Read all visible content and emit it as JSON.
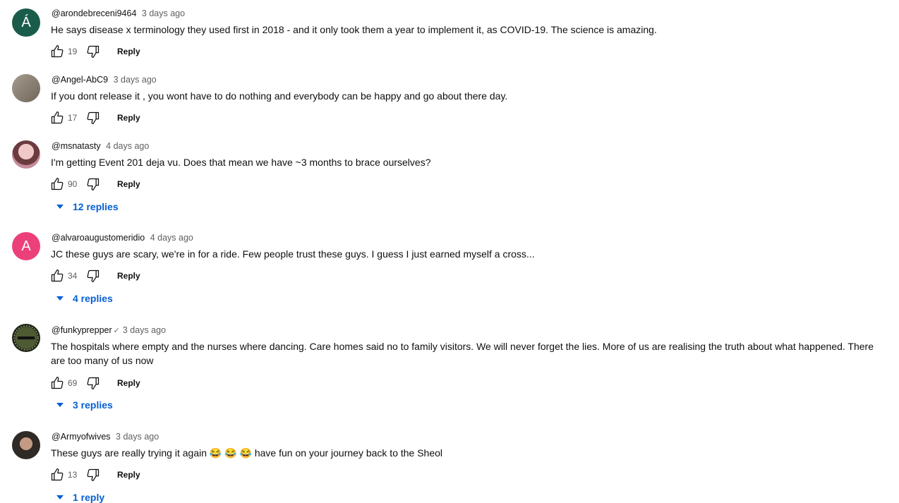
{
  "comments": [
    {
      "author": "@arondebreceni9464",
      "verified": false,
      "date": "3 days ago",
      "text": "He says disease x terminology they used first in 2018 - and it only took them a year to implement it, as COVID-19. The science is amazing.",
      "likes": "19",
      "reply_label": "Reply",
      "avatar": {
        "initial": "Á",
        "bg": "#1a5c4a"
      }
    },
    {
      "author": "@Angel-AbC9",
      "verified": false,
      "date": "3 days ago",
      "text": "If you dont release it , you wont have to do nothing and everybody can be happy and go about there day.",
      "likes": "17",
      "reply_label": "Reply",
      "avatar": {
        "initial": "",
        "bg": "#8d8578"
      }
    },
    {
      "author": "@msnatasty",
      "verified": false,
      "date": "4 days ago",
      "text": "I'm getting Event 201 deja vu. Does that mean we have ~3 months to brace ourselves?",
      "likes": "90",
      "reply_label": "Reply",
      "replies_label": "12 replies",
      "avatar": {
        "initial": "",
        "bg": "#c9a3a8"
      }
    },
    {
      "author": "@alvaroaugustomeridio",
      "verified": false,
      "date": "4 days ago",
      "text": "JC these guys are scary, we're in for a ride. Few people trust these guys. I guess I just earned myself a cross...",
      "likes": "34",
      "reply_label": "Reply",
      "replies_label": "4 replies",
      "avatar": {
        "initial": "A",
        "bg": "#ec407a"
      }
    },
    {
      "author": "@funkyprepper",
      "verified": true,
      "date": "3 days ago",
      "text": "The hospitals where empty and the nurses where dancing. Care homes said no to family visitors. We will never forget the lies. More of us are realising the truth about what happened. There are too many of us now",
      "likes": "69",
      "reply_label": "Reply",
      "replies_label": "3 replies",
      "avatar": {
        "initial": "",
        "bg": "#3a4a2a"
      }
    },
    {
      "author": "@Armyofwives",
      "verified": false,
      "date": "3 days ago",
      "text": "These guys are really trying it again 😂 😂 😂  have fun on your journey back to the Sheol",
      "likes": "13",
      "reply_label": "Reply",
      "replies_label": "1 reply",
      "avatar": {
        "initial": "",
        "bg": "#2f2a26"
      }
    }
  ],
  "icons": {
    "like": "thumbs-up-icon",
    "dislike": "thumbs-down-icon",
    "expand": "caret-down-icon",
    "verified": "checkmark-icon"
  },
  "colors": {
    "link": "#065fd4",
    "secondary_text": "#606060"
  }
}
